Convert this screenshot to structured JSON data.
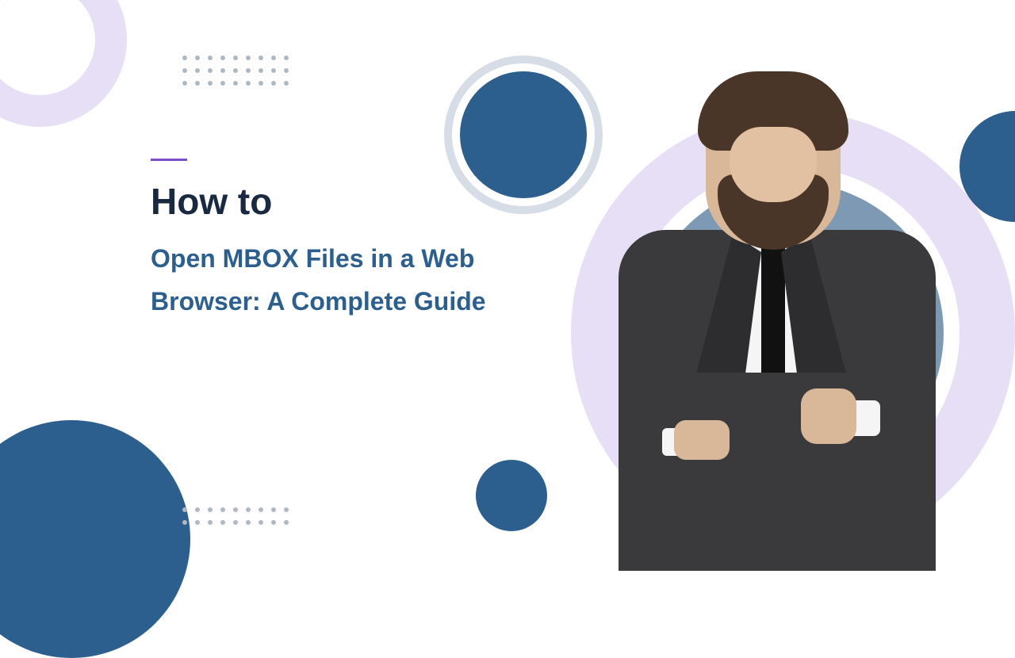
{
  "heading": {
    "lead": "How to",
    "main": "Open MBOX Files in a Web Browser: A Complete Guide"
  },
  "colors": {
    "primary": "#2c5f8d",
    "accent": "#7b4fc9",
    "lavender": "#e6dff5",
    "dark": "#1a2942"
  }
}
